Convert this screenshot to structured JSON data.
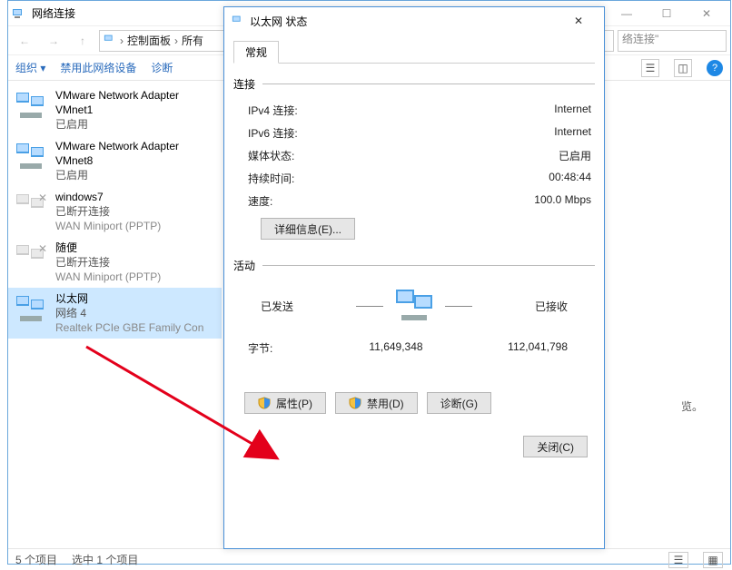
{
  "main_window": {
    "title": "网络连接",
    "breadcrumb": {
      "c1": "控制面板",
      "c2": "所有",
      "sep": "›"
    },
    "search_placeholder": "络连接\"",
    "toolbar": {
      "organize": "组织 ▾",
      "disable": "禁用此网络设备",
      "diagnose": "诊断"
    },
    "preview_hint": "览。",
    "items": [
      {
        "name": "VMware Network Adapter VMnet1",
        "status": "已启用",
        "device": ""
      },
      {
        "name": "VMware Network Adapter VMnet8",
        "status": "已启用",
        "device": ""
      },
      {
        "name": "windows7",
        "status": "已断开连接",
        "device": "WAN Miniport (PPTP)"
      },
      {
        "name": "随便",
        "status": "已断开连接",
        "device": "WAN Miniport (PPTP)"
      },
      {
        "name": "以太网",
        "status": "网络 4",
        "device": "Realtek PCIe GBE Family Con"
      }
    ],
    "status": {
      "count": "5 个项目",
      "selected": "选中 1 个项目"
    }
  },
  "dialog": {
    "title": "以太网 状态",
    "tab": "常规",
    "section_conn": "连接",
    "rows": [
      {
        "k": "IPv4 连接:",
        "v": "Internet"
      },
      {
        "k": "IPv6 连接:",
        "v": "Internet"
      },
      {
        "k": "媒体状态:",
        "v": "已启用"
      },
      {
        "k": "持续时间:",
        "v": "00:48:44"
      },
      {
        "k": "速度:",
        "v": "100.0 Mbps"
      }
    ],
    "details_btn": "详细信息(E)...",
    "section_act": "活动",
    "sent_label": "已发送",
    "recv_label": "已接收",
    "bytes_label": "字节:",
    "sent_bytes": "11,649,348",
    "recv_bytes": "112,041,798",
    "btn_props": "属性(P)",
    "btn_disable": "禁用(D)",
    "btn_diag": "诊断(G)",
    "btn_close": "关闭(C)"
  }
}
